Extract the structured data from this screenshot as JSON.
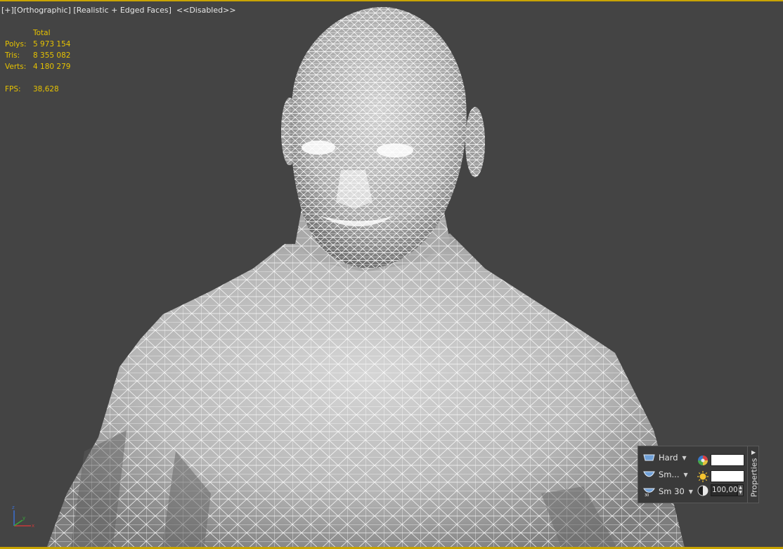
{
  "viewport": {
    "label": {
      "plus": "[+]",
      "view": "[Orthographic]",
      "shading": "[Realistic + Edged Faces]",
      "status": "<<Disabled>>"
    },
    "stats": {
      "header": "Total",
      "polys_label": "Polys:",
      "polys_value": "5 973 154",
      "tris_label": "Tris:",
      "tris_value": "8 355 082",
      "verts_label": "Verts:",
      "verts_value": "4 180 279",
      "fps_label": "FPS:",
      "fps_value": "38,628"
    },
    "border_color": "#c9a400",
    "stats_color": "#e6c200",
    "background": "#444444"
  },
  "properties_panel": {
    "row1_label": "Hard",
    "row2_label": "Sm...",
    "row3_label": "Sm 30",
    "opacity_value": "100,00",
    "tab_label": "Properties",
    "icons": [
      "smoothing-hard-icon",
      "smoothing-smooth-icon",
      "smoothing-30-icon",
      "color-wheel-icon",
      "light-bulb-icon",
      "opacity-icon"
    ]
  }
}
